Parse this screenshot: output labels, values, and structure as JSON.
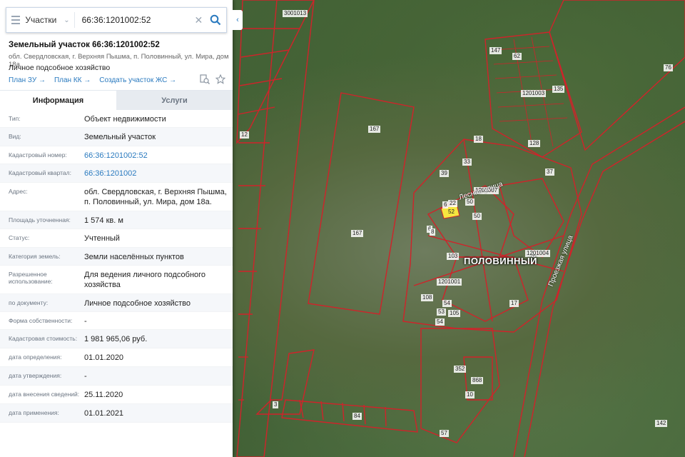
{
  "search": {
    "type_label": "Участки",
    "query": "66:36:1201002:52"
  },
  "object": {
    "title": "Земельный участок 66:36:1201002:52",
    "address": "обл. Свердловская, г. Верхняя Пышма, п. Половинный, ул. Мира, дом 18а.",
    "use": "Личное подсобное хозяйство"
  },
  "links": {
    "plan_zu": "План ЗУ →",
    "plan_kk": "План КК →",
    "create_zhs": "Создать участок ЖС →"
  },
  "tabs": {
    "info": "Информация",
    "services": "Услуги"
  },
  "rows": [
    {
      "label": "Тип:",
      "value": "Объект недвижимости"
    },
    {
      "label": "Вид:",
      "value": "Земельный участок"
    },
    {
      "label": "Кадастровый номер:",
      "value": "66:36:1201002:52"
    },
    {
      "label": "Кадастровый квартал:",
      "value": "66:36:1201002"
    },
    {
      "label": "Адрес:",
      "value": "обл. Свердловская, г. Верхняя Пышма, п. Половинный, ул. Мира, дом 18а."
    },
    {
      "label": "Площадь уточненная:",
      "value": "1 574 кв. м"
    },
    {
      "label": "Статус:",
      "value": "Учтенный"
    },
    {
      "label": "Категория земель:",
      "value": "Земли населённых пунктов"
    },
    {
      "label": "Разрешенное использование:",
      "value": "Для ведения личного подсобного хозяйства"
    },
    {
      "label": "по документу:",
      "value": "Личное подсобное хозяйство"
    },
    {
      "label": "Форма собственности:",
      "value": "-"
    },
    {
      "label": "Кадастровая стоимость:",
      "value": "1 981 965,06 руб."
    },
    {
      "label": "дата определения:",
      "value": "01.01.2020"
    },
    {
      "label": "дата утверждения:",
      "value": "-"
    },
    {
      "label": "дата внесения сведений:",
      "value": "25.11.2020"
    },
    {
      "label": "дата применения:",
      "value": "01.01.2021"
    }
  ],
  "map": {
    "place_name": "ПОЛОВИННЫЙ",
    "street_lesnaya": "Лесная улица",
    "street_proezzhaya": "Проезжая улица",
    "quarter_labels": [
      "1201007",
      "1201003",
      "1201004",
      "1201001",
      "3001013"
    ],
    "parcel_labels": [
      "167",
      "167",
      "52",
      "76",
      "142",
      "12",
      "6",
      "22",
      "50",
      "39",
      "54",
      "10",
      "6",
      "3",
      "17",
      "108",
      "105",
      "103",
      "50",
      "53",
      "37",
      "128",
      "135",
      "62",
      "147",
      "33",
      "54",
      "352",
      "868",
      "84",
      "57",
      "8",
      "18"
    ]
  },
  "colors": {
    "accent": "#2a7abf",
    "parcel_border": "#d0232a",
    "selected_parcel": "#f5e640"
  }
}
